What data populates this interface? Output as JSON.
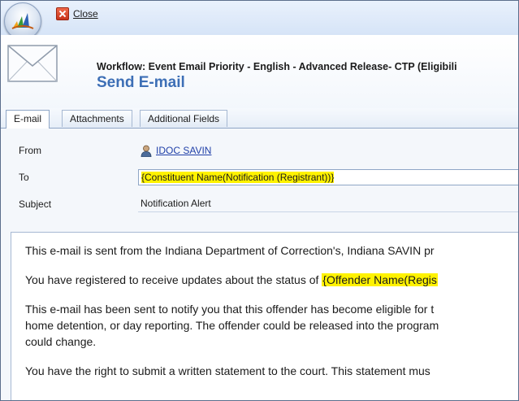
{
  "toolbar": {
    "close_label": "Close"
  },
  "header": {
    "workflow_title": "Workflow: Event Email Priority - English - Advanced Release- CTP (Eligibili",
    "form_title": "Send E-mail"
  },
  "tabs": [
    {
      "label": "E-mail",
      "active": true
    },
    {
      "label": "Attachments",
      "active": false
    },
    {
      "label": "Additional Fields",
      "active": false
    }
  ],
  "form": {
    "from": {
      "label": "From",
      "value": "IDOC SAVIN"
    },
    "to": {
      "label": "To",
      "value": "{Constituent Name(Notification (Registrant))}"
    },
    "subject": {
      "label": "Subject",
      "value": "Notification Alert"
    }
  },
  "body": {
    "p1": "This e-mail is sent from the Indiana Department of Correction's, Indiana  SAVIN pr",
    "p2_prefix": "You have  registered to receive updates about the status of ",
    "p2_highlight": "{Offender Name(Regis",
    "p3_line1": "This e-mail has been sent to notify you that  this offender has become eligible for t",
    "p3_line2": "home detention, or day reporting. The offender could be released into the program",
    "p3_line3": "could change.",
    "p4": "You have the right to submit a written statement to the court.  This statement mus"
  },
  "colors": {
    "title_blue": "#3d6fb6",
    "highlight": "#fff200",
    "link": "#1f3fa8"
  }
}
